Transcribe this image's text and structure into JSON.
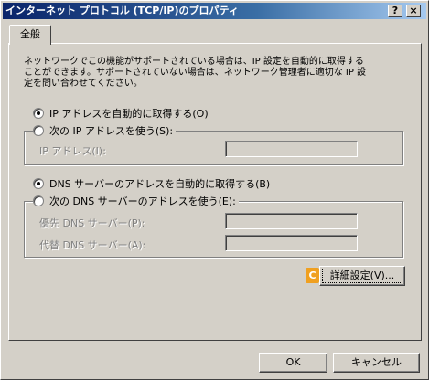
{
  "window": {
    "title": "インターネット プロトコル (TCP/IP)のプロパティ",
    "help_button": "?",
    "close_button": "×"
  },
  "tabs": [
    {
      "label": "全般"
    }
  ],
  "description": "ネットワークでこの機能がサポートされている場合は、IP 設定を自動的に取得する\nことができます。サポートされていない場合は、ネットワーク管理者に適切な IP 設\n定を問い合わせてください。",
  "ip": {
    "auto_label": "IP アドレスを自動的に取得する(O)",
    "manual_label": "次の IP アドレスを使う(S):",
    "address_label": "IP アドレス(I):",
    "address_value": "",
    "selected": "auto"
  },
  "dns": {
    "auto_label": "DNS サーバーのアドレスを自動的に取得する(B)",
    "manual_label": "次の DNS サーバーのアドレスを使う(E):",
    "preferred_label": "優先 DNS サーバー(P):",
    "alternate_label": "代替 DNS サーバー(A):",
    "preferred_value": "",
    "alternate_value": "",
    "selected": "auto"
  },
  "advanced_button": "詳細設定(V)...",
  "badge": {
    "text": "C",
    "color": "#f0a020"
  },
  "footer": {
    "ok": "OK",
    "cancel": "キャンセル"
  }
}
